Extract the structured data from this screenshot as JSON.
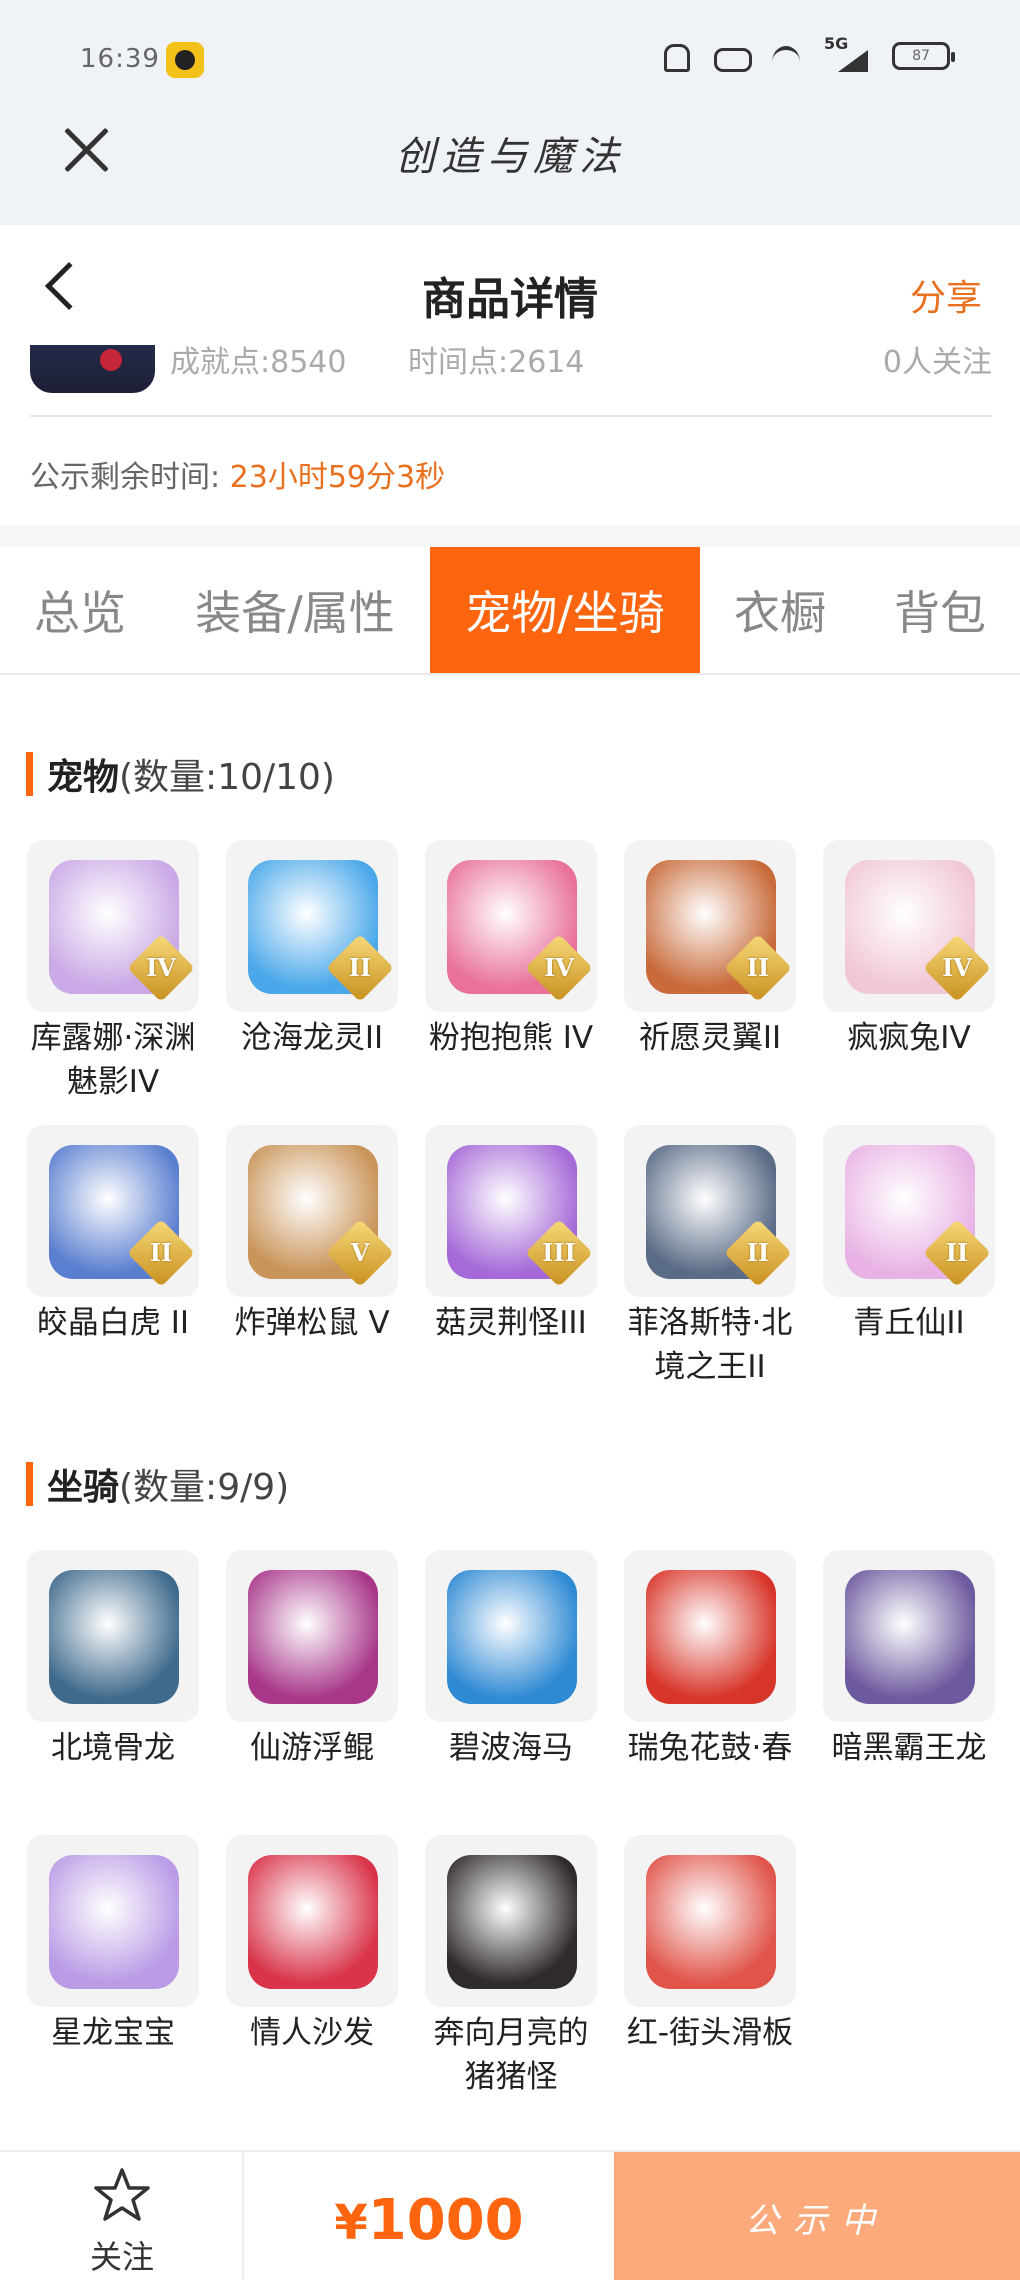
{
  "status_bar": {
    "time": "16:39",
    "battery": "87",
    "network": "5G",
    "icons": [
      "app-icon",
      "bell-mute-icon",
      "hd-icon",
      "wifi-icon",
      "signal-icon",
      "battery-icon"
    ]
  },
  "app": {
    "title": "创造与魔法"
  },
  "nav": {
    "title": "商品详情",
    "share_label": "分享"
  },
  "user": {
    "achievement": "成就点:8540",
    "time_points": "时间点:2614",
    "followers": "0人关注"
  },
  "countdown": {
    "label": "公示剩余时间:",
    "value": "23小时59分3秒"
  },
  "tabs": [
    {
      "label": "总览",
      "active": false
    },
    {
      "label": "装备/属性",
      "active": false
    },
    {
      "label": "宠物/坐骑",
      "active": true
    },
    {
      "label": "衣橱",
      "active": false
    },
    {
      "label": "背包",
      "active": false
    }
  ],
  "pets": {
    "title": "宠物",
    "count": "(数量:10/10)",
    "items": [
      {
        "name": "库露娜·深渊魅影IV",
        "badge": "IV",
        "color": "#c9a9e6",
        "icon": "pet-kuluna-icon"
      },
      {
        "name": "沧海龙灵II",
        "badge": "II",
        "color": "#4aa8ea",
        "icon": "pet-canghai-icon"
      },
      {
        "name": "粉抱抱熊 IV",
        "badge": "IV",
        "color": "#e9719a",
        "icon": "pet-bear-icon"
      },
      {
        "name": "祈愿灵翼II",
        "badge": "II",
        "color": "#c86a3a",
        "icon": "pet-eagle-icon"
      },
      {
        "name": "疯疯兔IV",
        "badge": "IV",
        "color": "#f0c7d6",
        "icon": "pet-rabbit-icon"
      },
      {
        "name": "皎晶白虎 II",
        "badge": "II",
        "color": "#5b7fd0",
        "icon": "pet-tiger-icon"
      },
      {
        "name": "炸弹松鼠 V",
        "badge": "V",
        "color": "#c99459",
        "icon": "pet-squirrel-icon"
      },
      {
        "name": "菇灵荆怪III",
        "badge": "III",
        "color": "#a56ad8",
        "icon": "pet-mushroom-icon"
      },
      {
        "name": "菲洛斯特·北境之王II",
        "badge": "II",
        "color": "#5a6b86",
        "icon": "pet-griffin-icon"
      },
      {
        "name": "青丘仙II",
        "badge": "II",
        "color": "#e8b3e4",
        "icon": "pet-fox-icon"
      }
    ]
  },
  "mounts": {
    "title": "坐骑",
    "count": "(数量:9/9)",
    "items": [
      {
        "name": "北境骨龙",
        "color": "#3f6a8c",
        "icon": "mount-bone-dragon-icon"
      },
      {
        "name": "仙游浮鲲",
        "color": "#a8378a",
        "icon": "mount-kun-icon"
      },
      {
        "name": "碧波海马",
        "color": "#2f8ad4",
        "icon": "mount-seahorse-icon"
      },
      {
        "name": "瑞兔花鼓·春",
        "color": "#d8352a",
        "icon": "mount-drum-icon"
      },
      {
        "name": "暗黑霸王龙",
        "color": "#6d5a9e",
        "icon": "mount-trex-icon"
      },
      {
        "name": "星龙宝宝",
        "color": "#b99be6",
        "icon": "mount-star-dragon-icon"
      },
      {
        "name": "情人沙发",
        "color": "#d9344a",
        "icon": "mount-sofa-icon"
      },
      {
        "name": "奔向月亮的猪猪怪",
        "color": "#2f2a2e",
        "icon": "mount-pig-icon"
      },
      {
        "name": "红-街头滑板",
        "color": "#e0544a",
        "icon": "mount-skateboard-icon"
      }
    ]
  },
  "bottom": {
    "follow_label": "关注",
    "currency": "¥",
    "price": "1000",
    "status_label": "公示中"
  },
  "colors": {
    "accent": "#ff640f",
    "accent_text": "#e8701f",
    "status_button": "#fca97c"
  }
}
